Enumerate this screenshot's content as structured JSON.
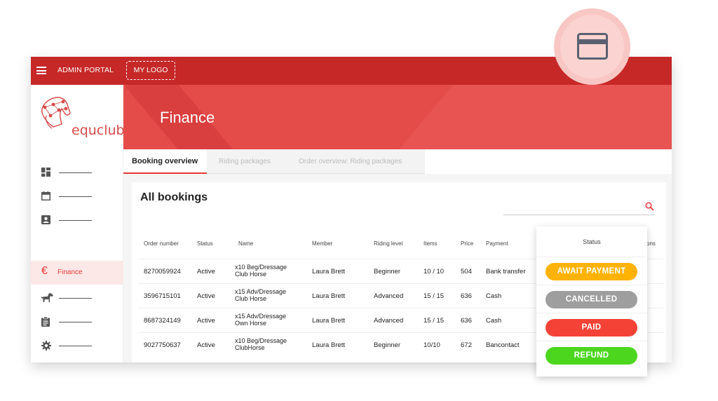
{
  "topbar": {
    "portal_title": "ADMIN PORTAL",
    "logo_placeholder": "MY LOGO"
  },
  "brand": {
    "name": "equclub"
  },
  "sidebar": {
    "items": [
      {
        "icon": "dashboard-icon",
        "label": ""
      },
      {
        "icon": "calendar-icon",
        "label": ""
      },
      {
        "icon": "contact-card-icon",
        "label": ""
      },
      {
        "icon": "euro-icon",
        "label": "Finance",
        "active": true
      },
      {
        "icon": "horse-icon",
        "label": ""
      },
      {
        "icon": "clipboard-icon",
        "label": ""
      },
      {
        "icon": "gear-icon",
        "label": ""
      }
    ]
  },
  "hero": {
    "title": "Finance"
  },
  "tabs": [
    {
      "label": "Booking overview",
      "active": true
    },
    {
      "label": "Riding packages"
    },
    {
      "label": "Order overview: Riding packages"
    }
  ],
  "card": {
    "title": "All bookings"
  },
  "table": {
    "headers": [
      "Order number",
      "Status",
      "Name",
      "Member",
      "Riding level",
      "Items",
      "Price",
      "Payment",
      "ons"
    ],
    "rows": [
      {
        "order": "8270059924",
        "status": "Active",
        "name1": "x10 Beg/Dressage",
        "name2": "Club Horse",
        "member": "Laura Brett",
        "level": "Beginner",
        "items": "10 / 10",
        "price": "504",
        "payment": "Bank transfer"
      },
      {
        "order": "3596715101",
        "status": "Active",
        "name1": "x15 Adv/Dressage",
        "name2": "Club Horse",
        "member": "Laura Brett",
        "level": "Advanced",
        "items": "15 / 15",
        "price": "636",
        "payment": "Cash"
      },
      {
        "order": "8687324149",
        "status": "Active",
        "name1": "x15 Adv/Dressage",
        "name2": "Own Horse",
        "member": "Laura Brett",
        "level": "Advanced",
        "items": "15 / 15",
        "price": "636",
        "payment": "Cash"
      },
      {
        "order": "9027750637",
        "status": "Active",
        "name1": "x10 Beg/Dressage",
        "name2": "ClubHorse",
        "member": "Laura Brett",
        "level": "Beginner",
        "items": "10/10",
        "price": "672",
        "payment": "Bancontact"
      }
    ]
  },
  "status_panel": {
    "header": "Status",
    "options": [
      {
        "label": "AWAIT PAYMENT",
        "color": "#ffb300"
      },
      {
        "label": "CANCELLED",
        "color": "#9e9e9e"
      },
      {
        "label": "PAID",
        "color": "#f44336"
      },
      {
        "label": "REFUND",
        "color": "#4cd61e"
      }
    ]
  },
  "colors": {
    "primary": "#c62828",
    "hero": "#e44c4a",
    "accent": "#e53935"
  },
  "fab": {
    "icon": "credit-card-icon"
  }
}
